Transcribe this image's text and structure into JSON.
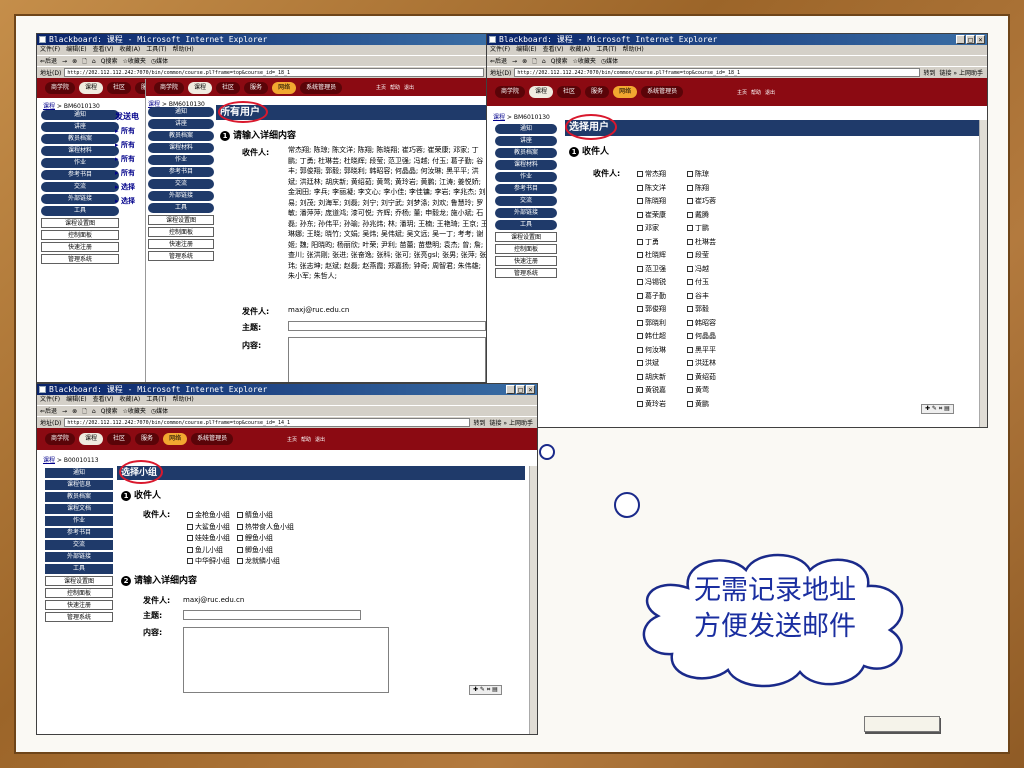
{
  "windowA": {
    "title": "Blackboard: 课程 - Microsoft Internet Explorer",
    "menu": [
      "文件(F)",
      "编辑(E)",
      "查看(V)",
      "收藏(A)",
      "工具(T)",
      "帮助(H)"
    ],
    "toolbar": [
      "⇐后退",
      "→",
      "⊗",
      "🗋",
      "⌂",
      "Q搜索",
      "☆收藏夹",
      "◷媒体"
    ],
    "addr_label": "地址(D)",
    "url": "http://202.112.112.242:7070/bin/common/course.pl?frame=top&course_id=_18_1",
    "go": "转到",
    "links": "链接 » 上网助手",
    "nav": {
      "tabs": [
        "商学院",
        "课程",
        "社区",
        "服务",
        "网络",
        "系统管理员"
      ],
      "icons": [
        "主页",
        "帮助",
        "退出"
      ]
    },
    "crumb": {
      "link": "课程",
      "sep": " > ",
      "course": "BM6010130"
    },
    "sidebar": [
      "通知",
      "讲座",
      "教员档案",
      "课程材料",
      "作业",
      "参考书目",
      "交流",
      "外部链接",
      "工具"
    ],
    "sidebar_sq": [
      "课程设置图",
      "控制面板",
      "快速注册",
      "管理系统"
    ],
    "page_title": "所有用户",
    "section1": "请输入详细内容",
    "recipient_label": "收件人:",
    "recipients": "常杰翔; 陈琼; 陈文洋; 陈翔; 陈晓翔; 崔巧蓉; 崔荣康; 邓家; 丁鹏; 丁勇; 杜琳芸; 杜晓辉; 段莹; 范卫强; 冯越; 付玉; 葛子勤; 谷丰; 郭俊翔; 郭毅; 郭晓利; 韩昭容; 何晶晶; 何汝琳; 黑平平; 洪斌; 洪廷林; 胡庆新; 黄绍茹; 黄莺; 黄玲岩; 黄鹏; 江涛; 姜悦娇; 金润田; 李兵; 李丽凝; 李文心; 李小佳; 李佳镛; 李岩; 李兆杰; 刘易; 刘茂; 刘海军; 刘磊; 刘宁; 刘宁武; 刘梦涤; 刘欢; 鲁慧玲; 罗敏; 潘萍萍; 庞道鸿; 漆可悦; 齐辉; 乔杨; 董; 申毅龙; 施小斌; 石磊; 孙东; 孙伟平; 孙瑜; 孙兆炜; 林; 潘玥; 王楠; 王艳琦; 王京; 王琳娜; 王晓; 晓竹; 文娟; 吴炜; 吴伟斌; 吴文远; 吴一丁; 考考; 谢姬; 魏; 阳晓昀; 杨丽欣; 叶荣; 尹利; 苗蕾; 苗懋明; 袁杰; 曾; 詹; 查川; 张洪刚; 张进; 张奋逸; 张科; 张可; 张亮gsl; 张男; 张萍; 张玮; 张志坤; 赵斌; 赵磊; 赵燕霞; 郑嘉扬; 钟奇; 周智君; 朱伟雄; 朱小军; 朱哲人;",
    "sender_label": "发件人:",
    "sender": "maxj@ruc.edu.cn",
    "subject_label": "主题:",
    "content_label": "内容:",
    "list_behind": [
      "发送电",
      "所有",
      "所有",
      "所有",
      "所有",
      "选择",
      "选择"
    ]
  },
  "windowB": {
    "title": "Blackboard: 课程 - Microsoft Internet Explorer",
    "menu": [
      "文件(F)",
      "编辑(E)",
      "查看(V)",
      "收藏(A)",
      "工具(T)",
      "帮助(H)"
    ],
    "toolbar": [
      "⇐后退",
      "→",
      "⊗",
      "🗋",
      "⌂",
      "Q搜索",
      "☆收藏夹",
      "◷媒体"
    ],
    "addr_label": "地址(D)",
    "url": "http://202.112.112.242:7070/bin/common/course.pl?frame=top&course_id=_18_1",
    "go": "转到",
    "links": "链接 » 上网助手",
    "nav": {
      "tabs": [
        "商学院",
        "课程",
        "社区",
        "服务",
        "网络",
        "系统管理员"
      ],
      "icons": [
        "主页",
        "帮助",
        "退出"
      ]
    },
    "crumb": {
      "link": "课程",
      "sep": " > ",
      "course": "BM6010130"
    },
    "sidebar": [
      "通知",
      "讲座",
      "教员档案",
      "课程材料",
      "作业",
      "参考书目",
      "交流",
      "外部链接",
      "工具"
    ],
    "sidebar_sq": [
      "课程设置图",
      "控制面板",
      "快速注册",
      "管理系统"
    ],
    "page_title": "选择用户",
    "section1": "收件人",
    "recipient_label": "收件人:",
    "pairs": [
      [
        "常杰翔",
        "陈琼"
      ],
      [
        "陈文洋",
        "陈翔"
      ],
      [
        "陈晓翔",
        "崔巧蓉"
      ],
      [
        "崔荣康",
        "戴腾"
      ],
      [
        "邓家",
        "丁鹏"
      ],
      [
        "丁勇",
        "杜琳芸"
      ],
      [
        "杜晓辉",
        "段莹"
      ],
      [
        "范卫强",
        "冯越"
      ],
      [
        "冯锡锐",
        "付玉"
      ],
      [
        "葛子勤",
        "谷丰"
      ],
      [
        "郭俊翔",
        "郭毅"
      ],
      [
        "郭晓利",
        "韩昭容"
      ],
      [
        "韩仕超",
        "何晶晶"
      ],
      [
        "何汝琳",
        "黑平平"
      ],
      [
        "洪斌",
        "洪廷林"
      ],
      [
        "胡庆新",
        "黄绍茹"
      ],
      [
        "黄锐嘉",
        "黄莺"
      ],
      [
        "黄玲岩",
        "黄鹏"
      ]
    ]
  },
  "windowC": {
    "title": "Blackboard: 课程 - Microsoft Internet Explorer",
    "menu": [
      "文件(F)",
      "编辑(E)",
      "查看(V)",
      "收藏(A)",
      "工具(T)",
      "帮助(H)"
    ],
    "toolbar": [
      "⇐后退",
      "→",
      "⊗",
      "🗋",
      "⌂",
      "Q搜索",
      "☆收藏夹",
      "◷媒体"
    ],
    "addr_label": "地址(D)",
    "url": "http://202.112.112.242:7070/bin/common/course.pl?frame=top&course_id=_14_1",
    "go": "转到",
    "links": "链接 » 上网助手",
    "nav": {
      "tabs": [
        "商学院",
        "课程",
        "社区",
        "服务",
        "网络",
        "系统管理员"
      ],
      "icons": [
        "主页",
        "帮助",
        "退出"
      ]
    },
    "crumb": {
      "link": "课程",
      "sep": " > ",
      "course": "B00010113"
    },
    "sidebar": [
      "通知",
      "课程信息",
      "教员档案",
      "课程文档",
      "作业",
      "参考书目",
      "交流",
      "外部链接",
      "工具"
    ],
    "sidebar_sq": [
      "课程设置图",
      "控制面板",
      "快速注册",
      "管理系统"
    ],
    "page_title": "选择小组",
    "section1": "收件人",
    "recipient_label": "收件人:",
    "groups": [
      [
        "金枪鱼小组",
        "鲭鱼小组"
      ],
      [
        "大鲨鱼小组",
        "热带食人鱼小组"
      ],
      [
        "娃娃鱼小组",
        "鲤鱼小组"
      ],
      [
        "鱼儿小组",
        "鲫鱼小组"
      ],
      [
        "中华鲟小组",
        "龙就鳞小组"
      ]
    ],
    "section2": "请输入详细内容",
    "sender_label": "发件人:",
    "sender": "maxj@ruc.edu.cn",
    "subject_label": "主题:",
    "content_label": "内容:"
  },
  "cloud": {
    "line1": "无需记录地址",
    "line2": "方便发送邮件"
  },
  "colors": {
    "navbar": "#8b0a12",
    "sidebar": "#1f3a6a",
    "highlight_circle": "#d9182d",
    "cloud_text": "#1a2ea0"
  }
}
